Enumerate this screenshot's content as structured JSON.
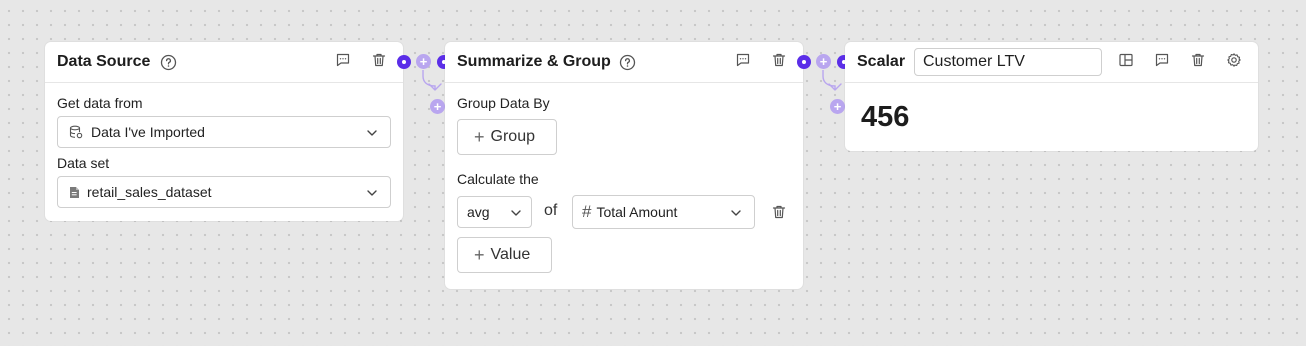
{
  "data_source": {
    "title": "Data Source",
    "get_data_label": "Get data from",
    "get_data_value": "Data I've Imported",
    "dataset_label": "Data set",
    "dataset_value": "retail_sales_dataset"
  },
  "summarize": {
    "title": "Summarize & Group",
    "group_by_label": "Group Data By",
    "group_button": "Group",
    "calculate_label": "Calculate the",
    "aggregation_value": "avg",
    "of_text": "of",
    "field_value": "Total Amount",
    "value_button": "Value"
  },
  "scalar": {
    "title": "Scalar",
    "name_input_value": "Customer LTV",
    "result_value": "456"
  },
  "colors": {
    "accent": "#5b2ee8",
    "accent_light": "#b9a6ef",
    "canvas": "#e7e7e7"
  }
}
